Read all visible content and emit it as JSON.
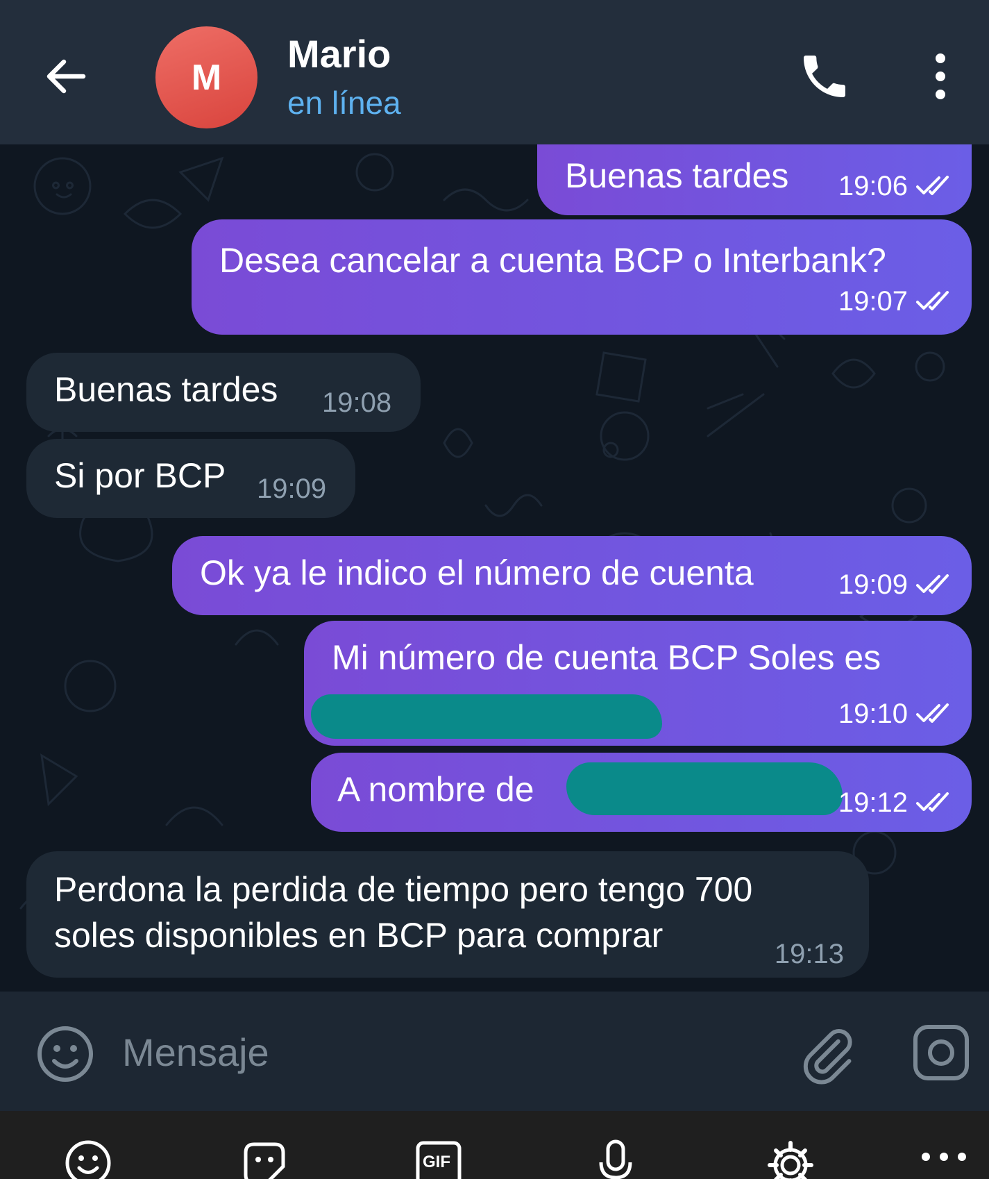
{
  "header": {
    "back_icon": "arrow-left-icon",
    "avatar_initial": "M",
    "avatar_color": "#e2554e",
    "contact_name": "Mario",
    "status": "en línea",
    "call_icon": "phone-icon",
    "menu_icon": "more-vertical-icon"
  },
  "messages": [
    {
      "dir": "out",
      "text": "Buenas tardes",
      "time": "19:06",
      "read": true
    },
    {
      "dir": "out",
      "text": "Desea cancelar a cuenta BCP o Interbank?",
      "time": "19:07",
      "read": true
    },
    {
      "dir": "in",
      "text": "Buenas tardes",
      "time": "19:08"
    },
    {
      "dir": "in",
      "text": "Si por BCP",
      "time": "19:09"
    },
    {
      "dir": "out",
      "text": "Ok ya le indico el número de cuenta",
      "time": "19:09",
      "read": true
    },
    {
      "dir": "out",
      "text": "Mi número de cuenta BCP Soles es",
      "time": "19:10",
      "read": true,
      "redacted": true
    },
    {
      "dir": "out",
      "text": "A nombre de",
      "time": "19:12",
      "read": true,
      "redacted": true
    },
    {
      "dir": "in",
      "text": "Perdona la perdida de tiempo pero tengo 700 soles disponibles en BCP para comprar",
      "time": "19:13"
    }
  ],
  "input": {
    "placeholder": "Mensaje",
    "emoji_icon": "emoji-icon",
    "attach_icon": "paperclip-icon",
    "camera_icon": "camera-icon"
  },
  "keyboard_toolbar": {
    "icons": [
      "emoji-icon",
      "sticker-icon",
      "gif-icon",
      "microphone-icon",
      "settings-icon",
      "more-horizontal-icon"
    ],
    "gif_label": "GIF"
  },
  "colors": {
    "header_bg": "#232e3c",
    "chat_bg": "#0f1721",
    "outgoing_bubble": "#6f55e0",
    "incoming_bubble": "#1e2935",
    "status_blue": "#5eb2f0",
    "redaction": "#0a8a8a"
  }
}
